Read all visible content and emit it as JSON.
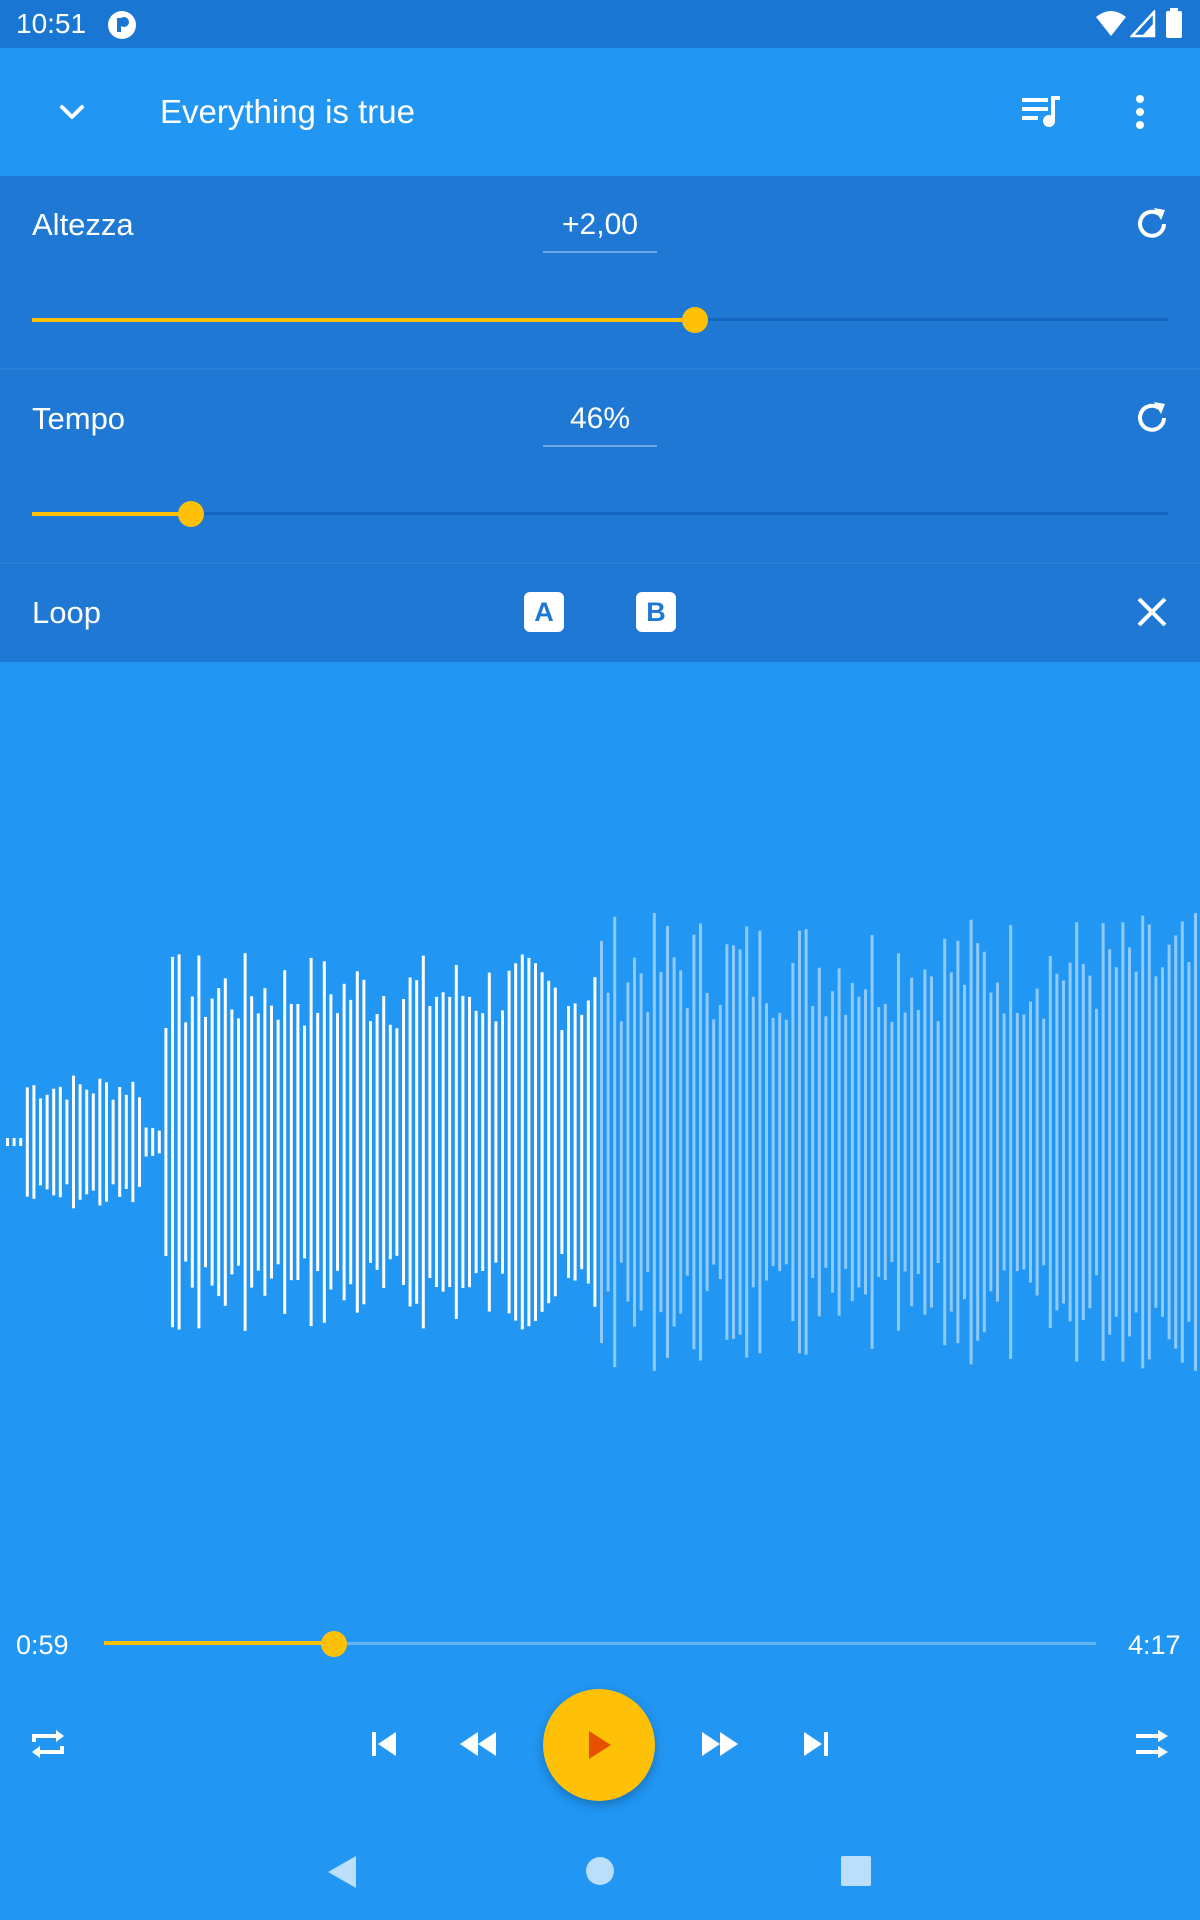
{
  "status_bar": {
    "time": "10:51"
  },
  "app_bar": {
    "title": "Everything is true"
  },
  "pitch": {
    "label": "Altezza",
    "value": "+2,00",
    "level_fraction": 0.584
  },
  "tempo": {
    "label": "Tempo",
    "value": "46%",
    "level_fraction": 0.14
  },
  "loop": {
    "label": "Loop",
    "a_label": "A",
    "b_label": "B"
  },
  "player": {
    "current_time": "0:59",
    "total_time": "4:17",
    "progress_fraction": 0.232
  },
  "colors": {
    "accent": "#FFC107",
    "primary": "#2196F3",
    "primary_dark": "#1976D2",
    "panel": "#1E78D4"
  },
  "icons": {
    "collapse": "chevron-down-icon",
    "queue": "queue-music-icon",
    "menu": "more-vert-icon",
    "reset": "refresh-icon",
    "close": "close-icon",
    "repeat": "repeat-icon",
    "previous": "skip-previous-icon",
    "rewind": "fast-rewind-icon",
    "play": "play-icon",
    "forward": "fast-forward-icon",
    "next": "skip-next-icon",
    "shuffle": "shuffle-icon"
  }
}
